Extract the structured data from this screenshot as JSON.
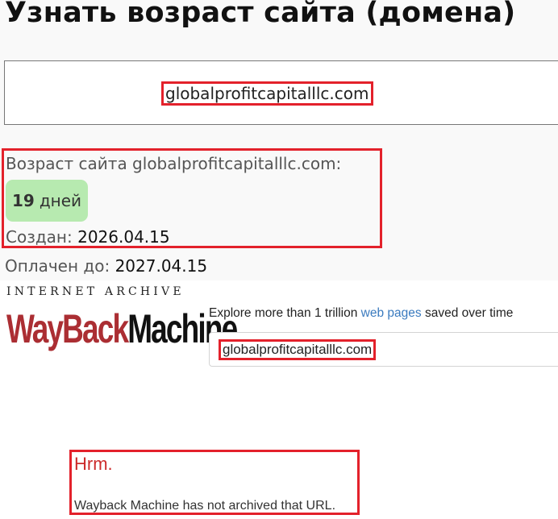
{
  "header": {
    "title": "Узнать возраст сайта (домена)"
  },
  "domain_input": {
    "value": "globalprofitcapitalllc.com"
  },
  "age": {
    "label": "Возраст сайта globalprofitcapitalllc.com:",
    "days_number": "19",
    "days_unit": "дней",
    "created_label": "Создан:",
    "created_value": "2026.04.15",
    "paid_label": "Оплачен до:",
    "paid_value": "2027.04.15"
  },
  "wayback": {
    "logo_top": "INTERNET ARCHIVE",
    "logo_way": "WayBack",
    "logo_machine": "Machine",
    "explore_prefix": "Explore more than 1 trillion ",
    "explore_link": "web pages",
    "explore_suffix": " saved over time",
    "search_value": "globalprofitcapitalllc.com",
    "error_title": "Hrm.",
    "error_message": "Wayback Machine has not archived that URL."
  },
  "colors": {
    "highlight": "#e3212b",
    "badge": "#b7eab0",
    "wayback_red": "#ab2e33",
    "link": "#3b7bbf"
  }
}
